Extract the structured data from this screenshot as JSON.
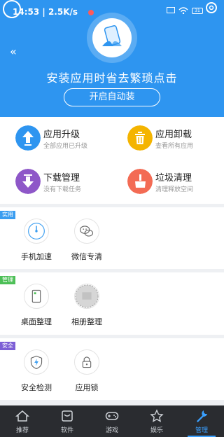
{
  "status_bar": {
    "time": "14:53",
    "speed": "| 2.5K/s",
    "battery": "31"
  },
  "header": {
    "title": "安装应用时省去繁琐点击",
    "auto_install_button": "开启自动装"
  },
  "grid": [
    {
      "title": "应用升级",
      "subtitle": "全部应用已升级",
      "icon": "upload-arrow-icon",
      "color": "#2e95f0"
    },
    {
      "title": "应用卸载",
      "subtitle": "查看所有应用",
      "icon": "trash-icon",
      "color": "#f4b400"
    },
    {
      "title": "下载管理",
      "subtitle": "没有下载任务",
      "icon": "download-arrow-icon",
      "color": "#8e57c8"
    },
    {
      "title": "垃圾清理",
      "subtitle": "清理释放空间",
      "icon": "broom-icon",
      "color": "#f36b54"
    }
  ],
  "sections": [
    {
      "tag": "实用",
      "tag_color": "#3a9df0",
      "items": [
        {
          "label": "手机加速",
          "icon": "speed-gauge-icon"
        },
        {
          "label": "微信专清",
          "icon": "wechat-icon"
        }
      ]
    },
    {
      "tag": "管理",
      "tag_color": "#4cbf56",
      "items": [
        {
          "label": "桌面整理",
          "icon": "desktop-tidy-icon"
        },
        {
          "label": "相册整理",
          "icon": "album-icon"
        }
      ]
    },
    {
      "tag": "安全",
      "tag_color": "#7d5fd6",
      "items": [
        {
          "label": "安全检测",
          "icon": "shield-icon"
        },
        {
          "label": "应用锁",
          "icon": "lock-icon"
        }
      ]
    }
  ],
  "nav": [
    {
      "label": "推荐",
      "icon": "home-icon"
    },
    {
      "label": "软件",
      "icon": "software-box-icon"
    },
    {
      "label": "游戏",
      "icon": "gamepad-icon"
    },
    {
      "label": "娱乐",
      "icon": "star-icon"
    },
    {
      "label": "管理",
      "icon": "wrench-icon",
      "active": true
    }
  ]
}
